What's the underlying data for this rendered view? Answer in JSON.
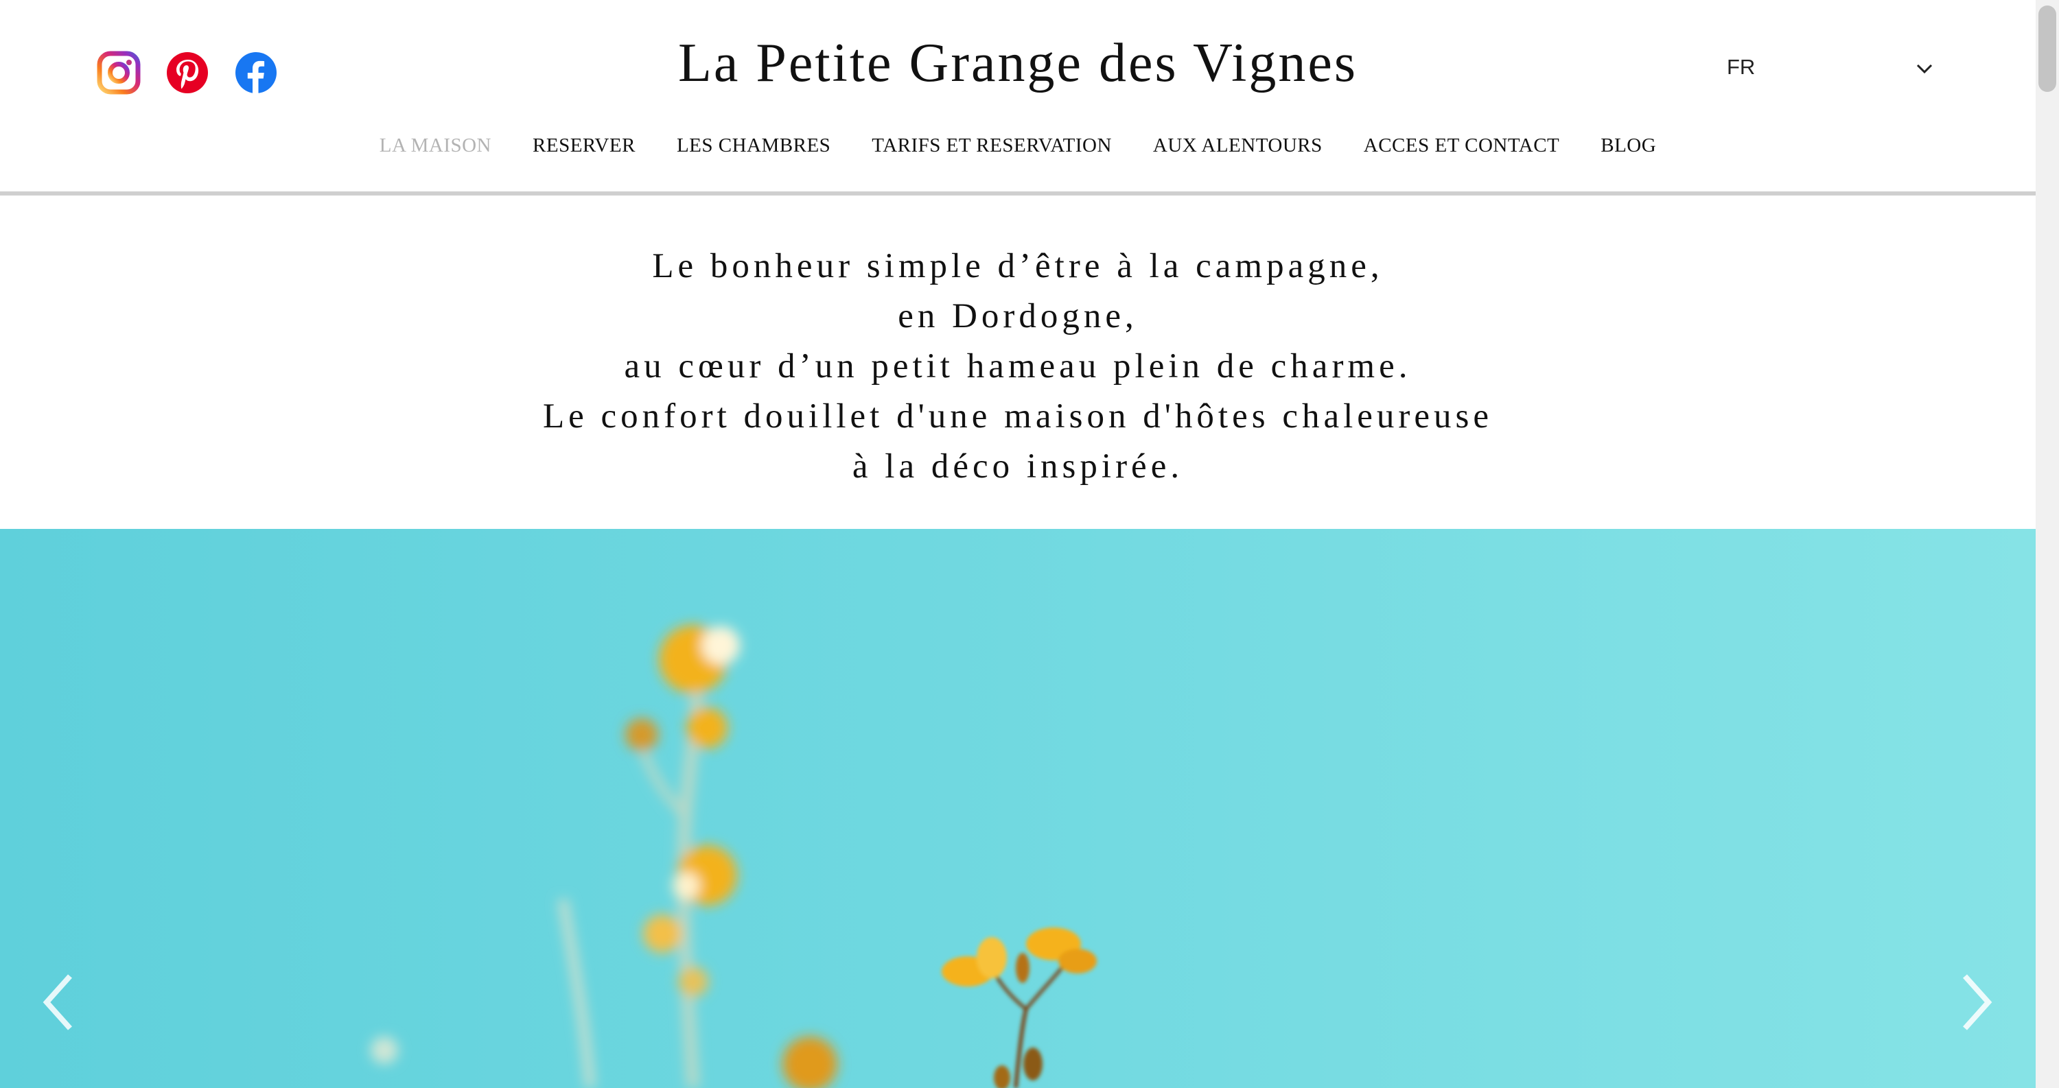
{
  "header": {
    "site_title": "La Petite Grange des Vignes",
    "socials": [
      {
        "name": "Instagram",
        "icon": "instagram-icon"
      },
      {
        "name": "Pinterest",
        "icon": "pinterest-icon",
        "color": "#e60023"
      },
      {
        "name": "Facebook",
        "icon": "facebook-icon",
        "color": "#1877f2"
      }
    ],
    "language": {
      "selected": "FR",
      "icon": "chevron-down-icon"
    }
  },
  "nav": {
    "items": [
      {
        "label": "LA MAISON",
        "active": true
      },
      {
        "label": "RESERVER"
      },
      {
        "label": "LES CHAMBRES"
      },
      {
        "label": "TARIFS ET RESERVATION"
      },
      {
        "label": "AUX ALENTOURS"
      },
      {
        "label": "ACCES ET CONTACT"
      },
      {
        "label": "BLOG"
      }
    ],
    "active_color": "#b3b3b3"
  },
  "intro": {
    "lines": [
      "Le bonheur simple d’être à la campagne,",
      "en Dordogne,",
      "au cœur d’un petit hameau plein de charme.",
      "Le confort douillet d'une maison d'hôtes chaleureuse",
      "à la déco inspirée."
    ]
  },
  "hero": {
    "sky_color": "#6fd8e0",
    "flower_color": "#f3b21a",
    "prev_icon": "chevron-left-icon",
    "next_icon": "chevron-right-icon"
  }
}
